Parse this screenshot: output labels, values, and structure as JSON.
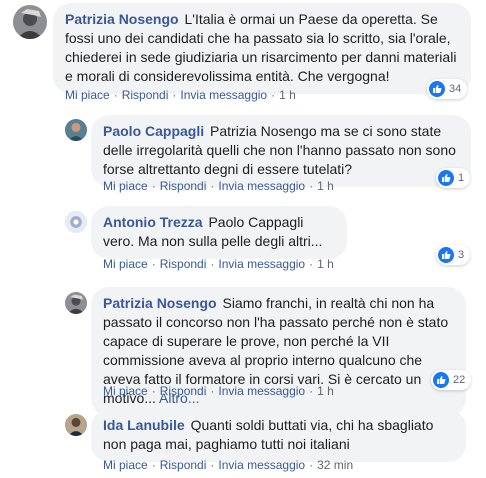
{
  "comments": [
    {
      "author": "Patrizia Nosengo",
      "text": "L'Italia è ormai un Paese da operetta. Se fossi uno dei candidati che ha passato sia lo scritto, sia l'orale, chiederei in sede giudiziaria un risarcimento per danni materiali e morali di considerevolissima entità. Che vergogna!",
      "more": "",
      "like": "Mi piace",
      "reply": "Rispondi",
      "message": "Invia messaggio",
      "time": "1 h",
      "reactions": "34",
      "reaction_icon": "thumbs-up-icon"
    },
    {
      "author": "Paolo Cappagli",
      "text": "Patrizia Nosengo ma se ci sono state delle irregolarità quelli che non l'hanno passato non sono forse altrettanto degni di essere tutelati?",
      "more": "",
      "like": "Mi piace",
      "reply": "Rispondi",
      "message": "Invia messaggio",
      "time": "1 h",
      "reactions": "1",
      "reaction_icon": "thumbs-up-icon"
    },
    {
      "author": "Antonio Trezza",
      "text": "Paolo Cappagli vero. Ma non sulla pelle degli altri...",
      "more": "",
      "like": "Mi piace",
      "reply": "Rispondi",
      "message": "Invia messaggio",
      "time": "1 h",
      "reactions": "3",
      "reaction_icon": "thumbs-up-icon"
    },
    {
      "author": "Patrizia Nosengo",
      "text": "Siamo franchi, in realtà chi non ha passato il concorso non l'ha passato perché non è stato capace di superare le prove, non perché la VII commissione aveva al proprio interno qualcuno che aveva fatto il formatore in corsi vari. Si è cercato un motivo...",
      "more": "Altro...",
      "like": "Mi piace",
      "reply": "Rispondi",
      "message": "Invia messaggio",
      "time": "1 h",
      "reactions": "22",
      "reaction_icon": "thumbs-up-icon"
    },
    {
      "author": "Ida Lanubile",
      "text": "Quanti soldi buttati via, chi ha sbagliato non paga mai, paghiamo tutti noi italiani",
      "more": "",
      "like": "Mi piace",
      "reply": "Rispondi",
      "message": "Invia messaggio",
      "time": "32 min",
      "reactions": "",
      "reaction_icon": ""
    }
  ],
  "colors": {
    "link": "#385898",
    "bubble": "#f2f3f5",
    "like_badge": "#1877f2",
    "meta": "#606770"
  }
}
